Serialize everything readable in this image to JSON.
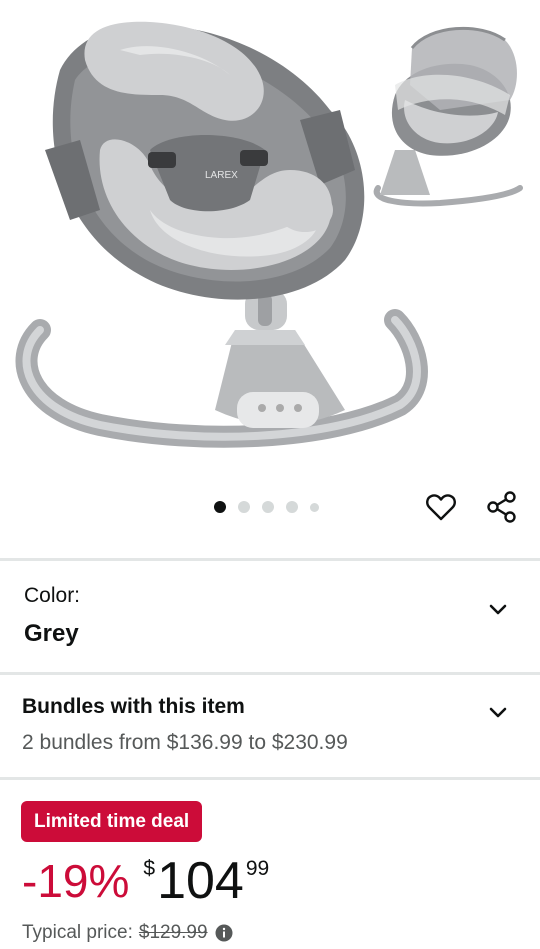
{
  "product_images": {
    "carousel_total": 5,
    "active_index": 0,
    "brand_mark": "LAREX",
    "colors": {
      "seat": "#7d7f82",
      "cushion": "#cfd0d2",
      "cushion_light": "#e4e5e6",
      "base": "#b9bbbd",
      "rail": "#a9abae"
    }
  },
  "actions": {
    "wishlist_icon": "heart-outline-icon",
    "share_icon": "share-icon"
  },
  "color_selector": {
    "label": "Color:",
    "value": "Grey"
  },
  "bundles": {
    "title": "Bundles with this item",
    "subtitle": "2 bundles from $136.99 to $230.99"
  },
  "deal": {
    "badge_label": "Limited time deal",
    "badge_color": "#cc0c39",
    "discount": "-19%",
    "price_symbol": "$",
    "price_whole": "104",
    "price_fraction": "99",
    "typical_label": "Typical price:",
    "typical_price": "$129.99"
  }
}
